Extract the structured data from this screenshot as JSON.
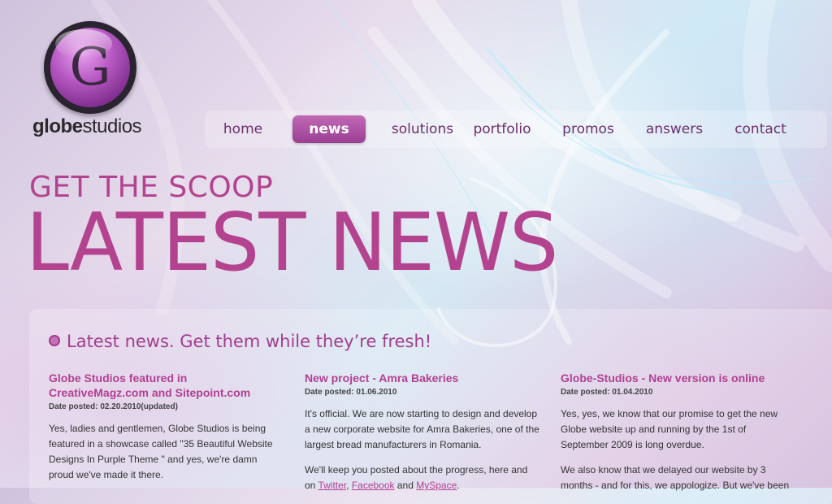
{
  "logo": {
    "glyph": "G",
    "brand_bold": "globe",
    "brand_regular": "studios"
  },
  "nav": {
    "items": [
      {
        "label": "home",
        "active": false
      },
      {
        "label": "news",
        "active": true
      },
      {
        "label": "solutions",
        "active": false
      },
      {
        "label": "portfolio",
        "active": false
      },
      {
        "label": "promos",
        "active": false
      },
      {
        "label": "answers",
        "active": false
      },
      {
        "label": "contact",
        "active": false
      }
    ]
  },
  "hero": {
    "kicker": "GET THE SCOOP",
    "title": "LATEST NEWS"
  },
  "news": {
    "tagline": "Latest news. Get them while they’re fresh!",
    "columns": [
      {
        "title": "Globe Studios featured in CreativeMagz.com and Sitepoint.com",
        "date": "Date posted: 02.20.2010(updated)",
        "paragraphs": [
          "Yes, ladies and gentlemen, Globe Studios is being featured in a showcase called \"35 Beautiful Website Designs In Purple Theme \" and yes, we're damn proud we've made it there."
        ]
      },
      {
        "title": "New project - Amra Bakeries",
        "date": "Date posted: 01.06.2010",
        "paragraphs": [
          "It's official. We are now starting to design and develop a new corporate website for Amra Bakeries, one of the largest bread manufacturers in Romania."
        ],
        "p2_prefix": "We'll keep you posted about the progress, here and on ",
        "link_twitter": "Twitter",
        "p2_sep": ", ",
        "link_facebook": "Facebook",
        "p2_and": " and ",
        "link_myspace": "MySpace",
        "p2_end": "."
      },
      {
        "title": "Globe-Studios - New version is online",
        "date": "Date posted: 01.04.2010",
        "paragraphs": [
          "Yes, yes, we know that our promise to get the new Globe website up and running by the 1st of September 2009 is long overdue.",
          "We also know that we delayed our website by 3 months - and for this, we appologize. But we've been"
        ]
      }
    ]
  },
  "colors": {
    "accent": "#b4438f",
    "nav_active": "#a84da0"
  }
}
